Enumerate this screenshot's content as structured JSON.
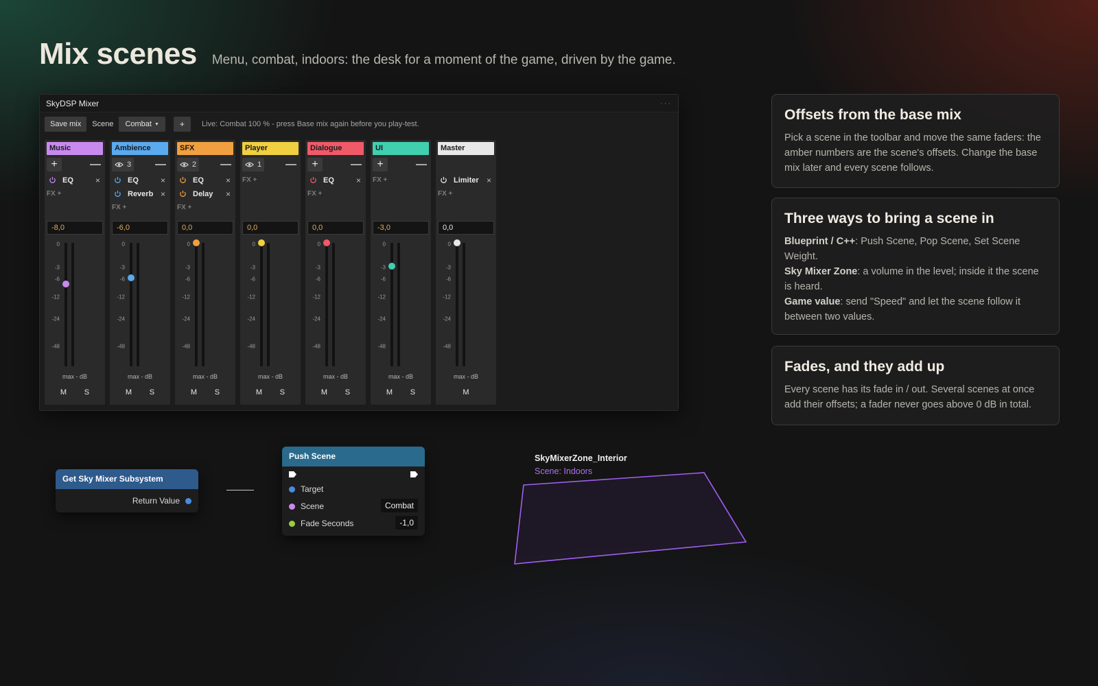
{
  "page": {
    "title": "Mix scenes",
    "subtitle": "Menu, combat, indoors: the desk for a moment of the game, driven by the game."
  },
  "mixer": {
    "window_title": "SkyDSP Mixer",
    "titlebar_menu": "···",
    "toolbar": {
      "save_label": "Save mix",
      "scene_label": "Scene",
      "scene_value": "Combat",
      "add_label": "+",
      "status": "Live: Combat 100 % - press Base mix again before you play-test."
    },
    "scale_labels": [
      "0",
      "-3",
      "-6",
      "-12",
      "-24",
      "-48"
    ],
    "strips": [
      {
        "name": "Music",
        "color": "#c98af0",
        "visible_count": "",
        "db": "-8,0",
        "footer": "max - dB",
        "mute": "M",
        "solo": "S",
        "effects": [
          {
            "name": "EQ",
            "close": "×"
          }
        ],
        "fx_add": "FX +"
      },
      {
        "name": "Ambience",
        "color": "#5aaaf0",
        "visible_count": "3",
        "db": "-6,0",
        "footer": "max - dB",
        "mute": "M",
        "solo": "S",
        "effects": [
          {
            "name": "EQ",
            "close": "×"
          },
          {
            "name": "Reverb",
            "close": "×"
          }
        ],
        "fx_add": "FX +"
      },
      {
        "name": "SFX",
        "color": "#f0a040",
        "visible_count": "2",
        "db": "0,0",
        "footer": "max - dB",
        "mute": "M",
        "solo": "S",
        "effects": [
          {
            "name": "EQ",
            "close": "×"
          },
          {
            "name": "Delay",
            "close": "×"
          }
        ],
        "fx_add": "FX +"
      },
      {
        "name": "Player",
        "color": "#f0d040",
        "visible_count": "1",
        "db": "0,0",
        "footer": "max - dB",
        "mute": "M",
        "solo": "S",
        "effects": [],
        "fx_add": "FX +"
      },
      {
        "name": "Dialogue",
        "color": "#f05a68",
        "visible_count": "",
        "db": "0,0",
        "footer": "max - dB",
        "mute": "M",
        "solo": "S",
        "effects": [
          {
            "name": "EQ",
            "close": "×"
          }
        ],
        "fx_add": "FX +"
      },
      {
        "name": "UI",
        "color": "#40d0b0",
        "visible_count": "",
        "db": "-3,0",
        "footer": "max - dB",
        "mute": "M",
        "solo": "S",
        "effects": [],
        "fx_add": "FX +"
      },
      {
        "name": "Master",
        "color": "#e8e8e8",
        "visible_count": "",
        "db": "0,0",
        "footer": "max - dB",
        "mute": "M",
        "solo": "",
        "effects": [
          {
            "name": "Limiter",
            "close": "×"
          }
        ],
        "fx_add": "FX +"
      }
    ],
    "offset_color": "#e3ad56"
  },
  "cards": [
    {
      "title": "Offsets from the base mix",
      "body": [
        {
          "text": "Pick a scene in the toolbar and move the same faders: the amber numbers are the scene's offsets. Change the base mix later and every scene follows."
        }
      ]
    },
    {
      "title": "Three ways to bring a scene in",
      "body": [
        {
          "bold": "Blueprint / C++",
          "text": ": Push Scene, Pop Scene, Set Scene Weight."
        },
        {
          "bold": "Sky Mixer Zone",
          "text": ": a volume in the level; inside it the scene is heard."
        },
        {
          "bold": "Game value",
          "text": ": send \"Speed\" and let the scene follow it between two values."
        }
      ]
    },
    {
      "title": "Fades, and they add up",
      "body": [
        {
          "text": "Every scene has its fade in / out. Several scenes at once add their offsets; a fader never goes above 0 dB in total."
        }
      ]
    }
  ],
  "blueprint": {
    "get_node": {
      "title": "Get Sky Mixer Subsystem",
      "output": "Return Value"
    },
    "push_node": {
      "title": "Push Scene",
      "pins": [
        {
          "label": "Target",
          "value": "",
          "color": "#4a8ae0"
        },
        {
          "label": "Scene",
          "value": "Combat",
          "color": "#c98af0"
        },
        {
          "label": "Fade Seconds",
          "value": "-1,0",
          "color": "#9ccc40"
        }
      ]
    }
  },
  "zone": {
    "name": "SkyMixerZone_Interior",
    "scene": "Scene: Indoors",
    "color": "#a060f0"
  }
}
